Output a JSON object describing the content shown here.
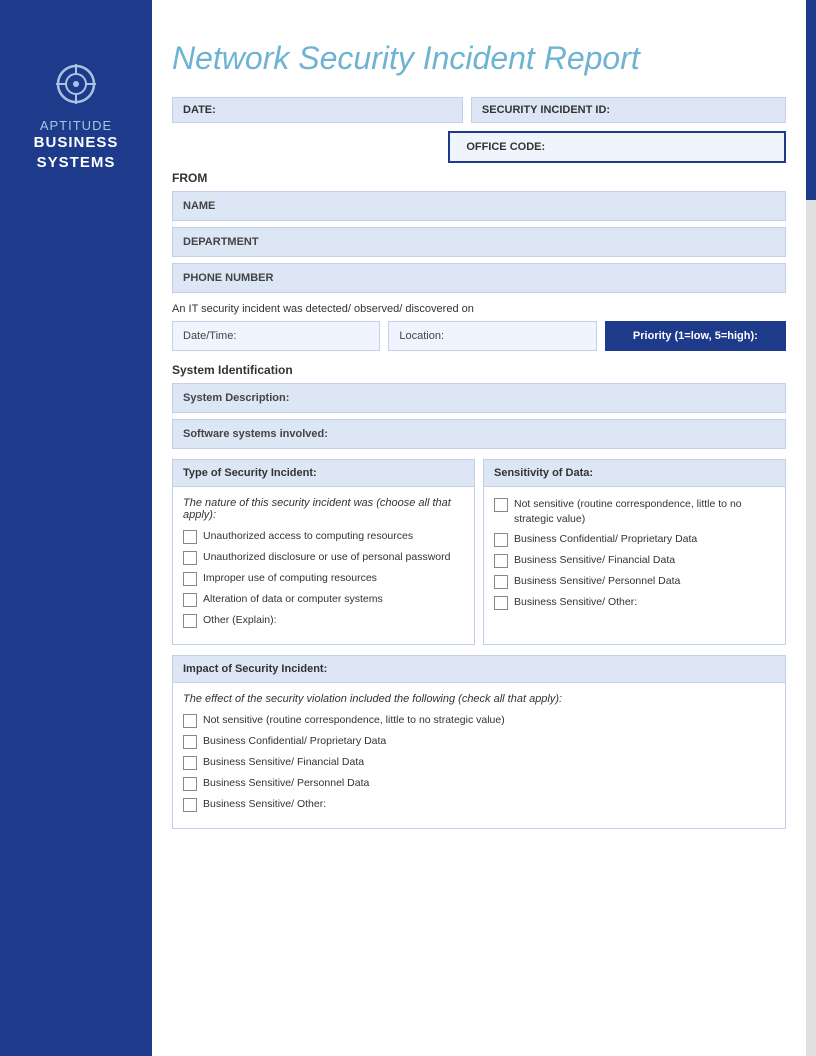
{
  "sidebar": {
    "icon_label": "target-icon",
    "title_top": "APTITUDE",
    "title_bottom": "BUSINESS\nSYSTEMS"
  },
  "report": {
    "title": "Network Security Incident Report"
  },
  "form": {
    "date_label": "DATE:",
    "security_id_label": "SECURITY INCIDENT ID:",
    "office_code_label": "OFFICE CODE:",
    "from_label": "FROM",
    "name_label": "NAME",
    "department_label": "DEPARTMENT",
    "phone_label": "PHONE NUMBER",
    "incident_detected_text": "An IT security incident was detected/ observed/ discovered on",
    "date_time_label": "Date/Time:",
    "location_label": "Location:",
    "priority_label": "Priority (1=low, 5=high):",
    "system_identification_label": "System Identification",
    "system_description_label": "System Description:",
    "software_systems_label": "Software systems involved:",
    "type_of_incident_header": "Type of Security Incident:",
    "sensitivity_header": "Sensitivity of Data:",
    "nature_text": "The nature of this security incident was (choose all that apply):",
    "type_checkboxes": [
      "Unauthorized access to computing resources",
      "Unauthorized disclosure or use of personal password",
      "Improper use of computing resources",
      "Alteration of data or computer systems",
      "Other (Explain):"
    ],
    "sensitivity_checkboxes": [
      "Not sensitive (routine correspondence, little to no strategic value)",
      "Business Confidential/ Proprietary Data",
      "Business Sensitive/ Financial Data",
      "Business Sensitive/ Personnel Data",
      "Business Sensitive/ Other:"
    ],
    "impact_header": "Impact of Security Incident:",
    "impact_title": "The effect of the security violation included the following (check all that apply):",
    "impact_checkboxes": [
      "Not sensitive (routine correspondence, little to no strategic value)",
      "Business Confidential/ Proprietary Data",
      "Business Sensitive/ Financial Data",
      "Business Sensitive/ Personnel Data",
      "Business Sensitive/ Other:"
    ]
  }
}
